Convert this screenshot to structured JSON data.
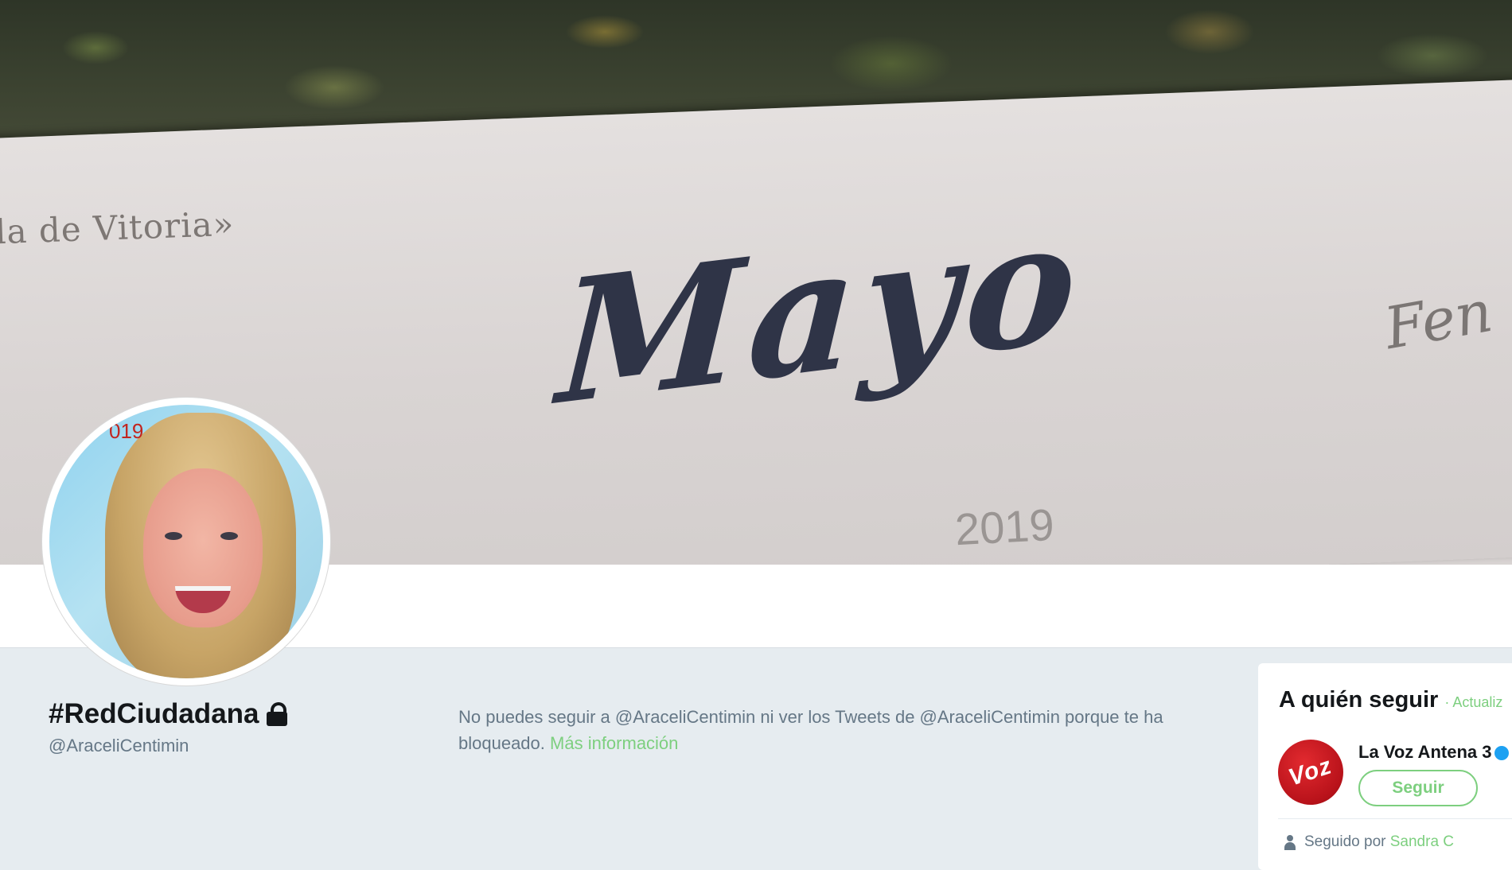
{
  "banner": {
    "left_text": "la de Vitoria»",
    "title": "Mayo",
    "year": "2019",
    "right_text": "Fen"
  },
  "avatar": {
    "stamp_text": "019"
  },
  "profile": {
    "name": "#RedCiudadana",
    "handle": "@AraceliCentimin",
    "locked_icon": "lock-icon"
  },
  "blocked_notice": {
    "message": "No puedes seguir a @AraceliCentimin ni ver los Tweets de @AraceliCentimin porque te ha bloqueado.",
    "link_label": "Más información"
  },
  "who_to_follow": {
    "title": "A quién seguir",
    "refresh_label": "· Actualiz",
    "suggestions": [
      {
        "name": "La Voz Antena 3",
        "logo_text": "Voz",
        "follow_label": "Seguir",
        "followed_by_prefix": "Seguido por",
        "followed_by_name": "Sandra C"
      }
    ]
  },
  "colors": {
    "accent": "#7dcf7f",
    "page_background": "#e6ecf0",
    "text_primary": "#14171a",
    "text_secondary": "#657786"
  }
}
